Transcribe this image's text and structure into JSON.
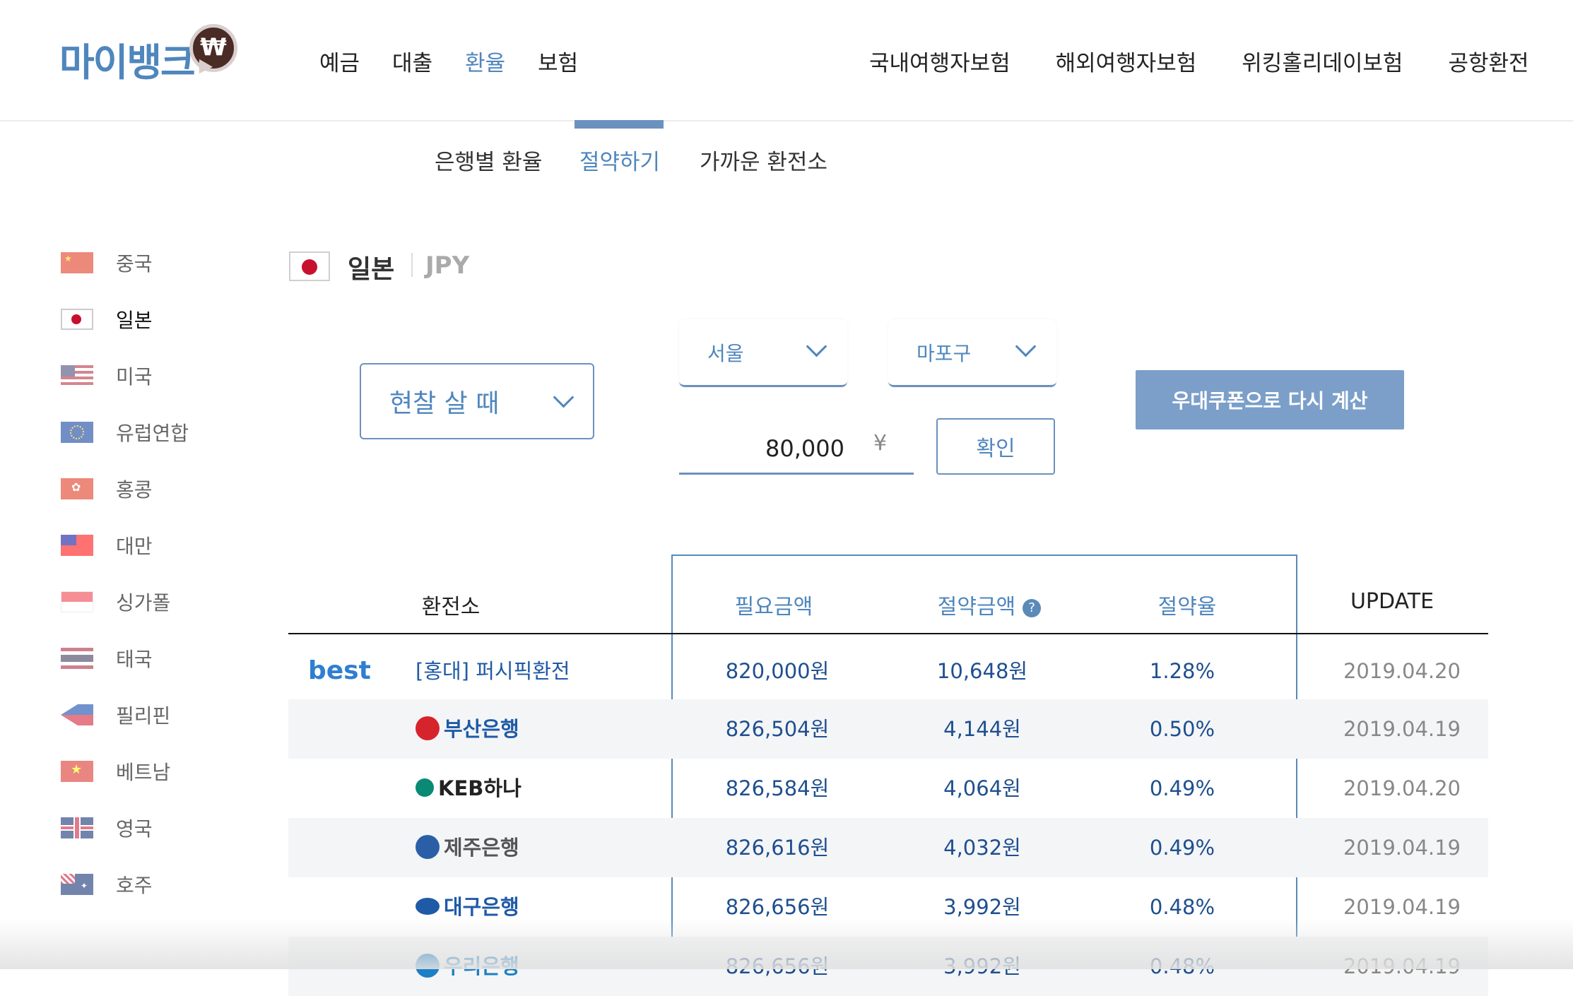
{
  "logo": {
    "text": "마이뱅크",
    "mark": "₩"
  },
  "nav_main": [
    {
      "label": "예금",
      "active": false
    },
    {
      "label": "대출",
      "active": false
    },
    {
      "label": "환율",
      "active": true
    },
    {
      "label": "보험",
      "active": false
    }
  ],
  "nav_right": [
    "국내여행자보험",
    "해외여행자보험",
    "위킹홀리데이보험",
    "공항환전"
  ],
  "sub_tabs": [
    {
      "label": "은행별 환율",
      "active": false
    },
    {
      "label": "절약하기",
      "active": true
    },
    {
      "label": "가까운 환전소",
      "active": false
    }
  ],
  "sidebar": [
    {
      "label": "중국",
      "flag": "china-flag-icon",
      "active": false
    },
    {
      "label": "일본",
      "flag": "japan-flag-icon",
      "active": true
    },
    {
      "label": "미국",
      "flag": "usa-flag-icon",
      "active": false
    },
    {
      "label": "유럽연합",
      "flag": "eu-flag-icon",
      "active": false
    },
    {
      "label": "홍콩",
      "flag": "hongkong-flag-icon",
      "active": false
    },
    {
      "label": "대만",
      "flag": "taiwan-flag-icon",
      "active": false
    },
    {
      "label": "싱가폴",
      "flag": "singapore-flag-icon",
      "active": false
    },
    {
      "label": "태국",
      "flag": "thailand-flag-icon",
      "active": false
    },
    {
      "label": "필리핀",
      "flag": "philippines-flag-icon",
      "active": false
    },
    {
      "label": "베트남",
      "flag": "vietnam-flag-icon",
      "active": false
    },
    {
      "label": "영국",
      "flag": "uk-flag-icon",
      "active": false
    },
    {
      "label": "호주",
      "flag": "australia-flag-icon",
      "active": false
    }
  ],
  "currency": {
    "name": "일본",
    "code": "JPY"
  },
  "controls": {
    "cash_type": "현찰 살 때",
    "city": "서울",
    "district": "마포구",
    "amount": "80,000",
    "currency_symbol": "¥",
    "confirm_label": "확인",
    "coupon_label": "우대쿠폰으로 다시 계산"
  },
  "table": {
    "headers": {
      "exchange": "환전소",
      "required": "필요금액",
      "saved": "절약금액",
      "rate": "절약율",
      "update": "UPDATE"
    },
    "best_label": "best",
    "rows": [
      {
        "name": "[홍대] 퍼시픽환전",
        "required": "820,000원",
        "saved": "10,648원",
        "rate": "1.28%",
        "date": "2019.04.20",
        "best": true,
        "icon": ""
      },
      {
        "name": "부산은행",
        "required": "826,504원",
        "saved": "4,144원",
        "rate": "0.50%",
        "date": "2019.04.19",
        "best": false,
        "icon": "busan-bank-logo-icon",
        "color": "#d6242c"
      },
      {
        "name": "KEB하나",
        "required": "826,584원",
        "saved": "4,064원",
        "rate": "0.49%",
        "date": "2019.04.20",
        "best": false,
        "icon": "keb-hana-logo-icon",
        "color": "#0a8a74"
      },
      {
        "name": "제주은행",
        "required": "826,616원",
        "saved": "4,032원",
        "rate": "0.49%",
        "date": "2019.04.19",
        "best": false,
        "icon": "jeju-bank-logo-icon",
        "color": "#2a5fa8"
      },
      {
        "name": "대구은행",
        "required": "826,656원",
        "saved": "3,992원",
        "rate": "0.48%",
        "date": "2019.04.19",
        "best": false,
        "icon": "daegu-bank-logo-icon",
        "color": "#1f5aa6"
      },
      {
        "name": "우리은행",
        "required": "826,656원",
        "saved": "3,992원",
        "rate": "0.48%",
        "date": "2019.04.19",
        "best": false,
        "icon": "woori-bank-logo-icon",
        "color": "#1d7fc4"
      }
    ]
  }
}
